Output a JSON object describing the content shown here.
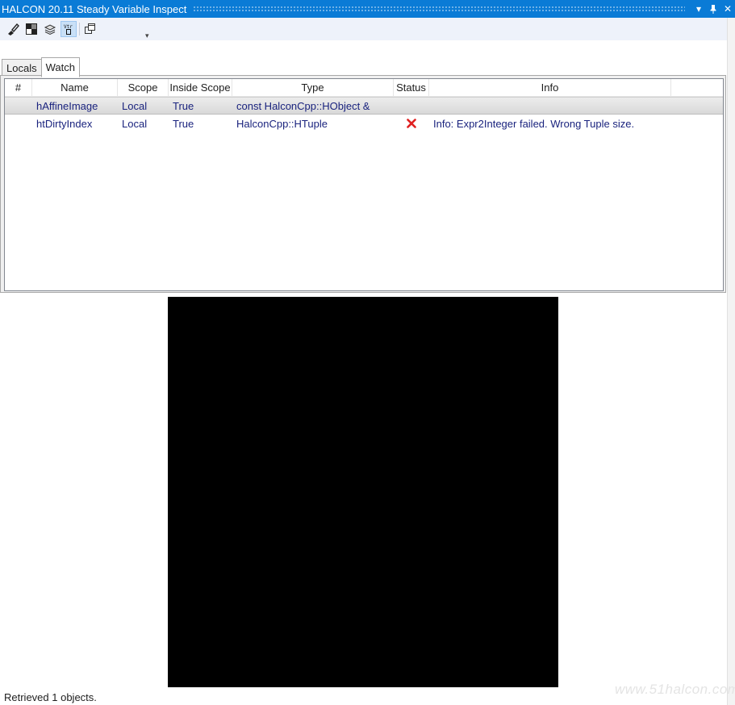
{
  "window": {
    "title": "HALCON 20.11 Steady Variable Inspect",
    "buttons": {
      "dropdown": "▾",
      "pin": "⊥",
      "close": "✕"
    }
  },
  "toolbar": {
    "tools": [
      "brush-icon",
      "image-contrast-icon",
      "layers-icon",
      "tuple-icon",
      "window-icon"
    ],
    "active_tool": "tuple-icon",
    "overflow": "▾"
  },
  "tabs": [
    {
      "label": "Locals",
      "selected": false
    },
    {
      "label": "Watch",
      "selected": true
    }
  ],
  "watch_table": {
    "columns": [
      "#",
      "Name",
      "Scope",
      "Inside Scope",
      "Type",
      "Status",
      "Info"
    ],
    "rows": [
      {
        "index": "",
        "name": "hAffineImage",
        "scope": "Local",
        "inside_scope": "True",
        "type": "const HalconCpp::HObject &",
        "status": "",
        "info": "",
        "selected": true
      },
      {
        "index": "",
        "name": "htDirtyIndex",
        "scope": "Local",
        "inside_scope": "True",
        "type": "HalconCpp::HTuple",
        "status": "error-x-icon",
        "info": "Info: Expr2Integer failed. Wrong Tuple size.",
        "selected": false
      }
    ]
  },
  "status_bar": {
    "text": "Retrieved 1 objects."
  },
  "watermark": "www.51halcon.com",
  "colors": {
    "accent": "#0a7bd6",
    "error": "#e02020",
    "text_value": "#1a237e"
  }
}
